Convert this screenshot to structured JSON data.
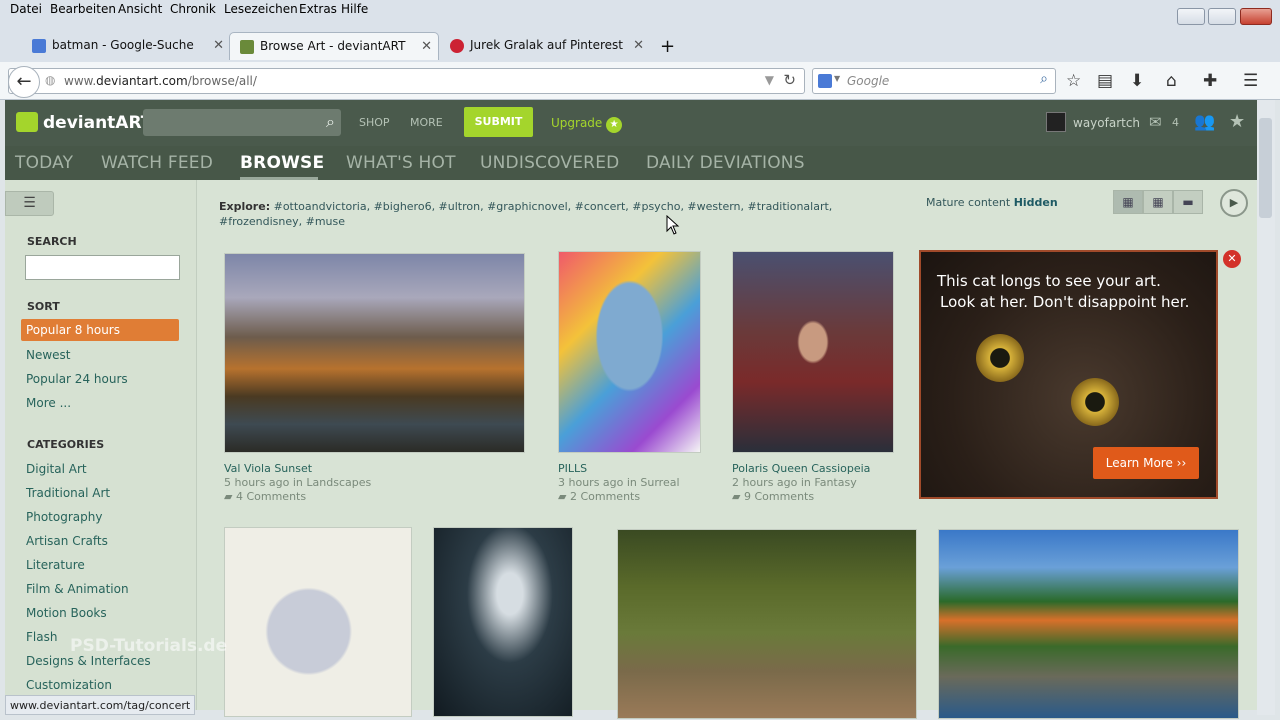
{
  "browser": {
    "menu": [
      "Datei",
      "Bearbeiten",
      "Ansicht",
      "Chronik",
      "Lesezeichen",
      "Extras",
      "Hilfe"
    ],
    "tabs": [
      {
        "label": "batman - Google-Suche",
        "favicon_color": "#4a7ad6"
      },
      {
        "label": "Browse Art - deviantART",
        "favicon_color": "#6a8a3a"
      },
      {
        "label": "Jurek Gralak auf Pinterest",
        "favicon_color": "#cc2233"
      }
    ],
    "new_tab": "+",
    "url_prefix": "www.",
    "url_domain": "deviantart.com",
    "url_path": "/browse/all/",
    "search_placeholder": "Google",
    "status_url": "www.deviantart.com/tag/concert"
  },
  "da": {
    "logo": "deviantART",
    "shop": "SHOP",
    "more": "MORE",
    "submit": "SUBMIT",
    "upgrade": "Upgrade",
    "username": "wayofartch",
    "message_count": "4",
    "nav": [
      "TODAY",
      "WATCH FEED",
      "BROWSE",
      "WHAT'S HOT",
      "UNDISCOVERED",
      "DAILY DEVIATIONS"
    ],
    "sidebar": {
      "search_heading": "SEARCH",
      "sort_heading": "SORT",
      "sort": [
        "Popular 8 hours",
        "Newest",
        "Popular 24 hours",
        "More ..."
      ],
      "categories_heading": "CATEGORIES",
      "categories": [
        "Digital Art",
        "Traditional Art",
        "Photography",
        "Artisan Crafts",
        "Literature",
        "Film & Animation",
        "Motion Books",
        "Flash",
        "Designs & Interfaces",
        "Customization"
      ]
    },
    "explore_label": "Explore:",
    "explore_tags": "#ottoandvictoria, #bighero6, #ultron, #graphicnovel, #concert, #psycho, #western, #traditionalart, #frozendisney, #muse",
    "mature_label": "Mature content",
    "mature_value": "Hidden",
    "deviations": [
      {
        "title": "Val Viola Sunset",
        "meta": "5 hours ago in Landscapes",
        "comments": "4 Comments"
      },
      {
        "title": "PILLS",
        "meta": "3 hours ago in Surreal",
        "comments": "2 Comments"
      },
      {
        "title": "Polaris Queen Cassiopeia",
        "meta": "2 hours ago in Fantasy",
        "comments": "9 Comments"
      }
    ],
    "ad": {
      "line1": "This cat longs to see your art.",
      "line2": "Look at her. Don't disappoint her.",
      "button": "Learn More ››"
    }
  },
  "watermark": "PSD-Tutorials.de"
}
